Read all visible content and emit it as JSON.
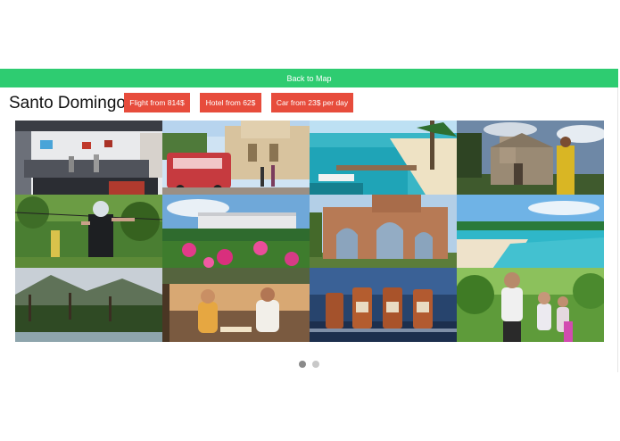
{
  "nav": {
    "back_label": "Back to Map"
  },
  "destination": {
    "name": "Santo Domingo"
  },
  "deals": {
    "flight": "Flight from 814$",
    "hotel": "Hotel from 62$",
    "car": "Car from 23$ per day"
  },
  "gallery": {
    "photos": [
      "office-interior-photo",
      "colonial-street-bus-photo",
      "beach-marina-photo",
      "stone-church-photo",
      "zipline-jungle-photo",
      "hotel-garden-photo",
      "ruins-arches-photo",
      "tropical-beach-photo",
      "mountain-palms-photo",
      "couple-dinner-photo",
      "rum-bottles-photo",
      "segway-tour-photo"
    ]
  },
  "carousel": {
    "pages": 2,
    "current": 1
  },
  "colors": {
    "accent_green": "#2ecc71",
    "deal_red": "#e74c3c"
  }
}
